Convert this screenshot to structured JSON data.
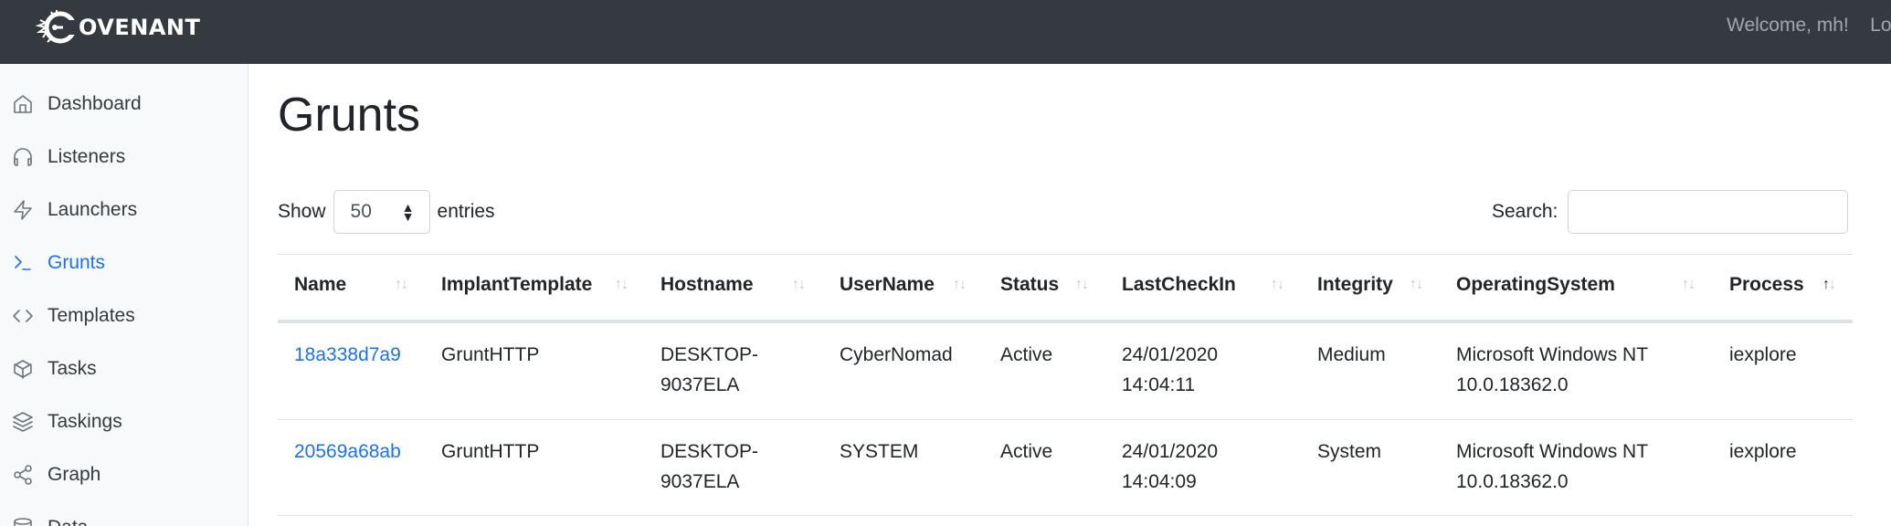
{
  "app": {
    "brand": "OVENANT",
    "welcome": "Welcome, mh!",
    "logout_partial": "Lo"
  },
  "sidebar": {
    "items": [
      {
        "label": "Dashboard",
        "icon": "home-icon"
      },
      {
        "label": "Listeners",
        "icon": "headphones-icon"
      },
      {
        "label": "Launchers",
        "icon": "zap-icon"
      },
      {
        "label": "Grunts",
        "icon": "terminal-icon",
        "active": true
      },
      {
        "label": "Templates",
        "icon": "code-icon"
      },
      {
        "label": "Tasks",
        "icon": "box-icon"
      },
      {
        "label": "Taskings",
        "icon": "layers-icon"
      },
      {
        "label": "Graph",
        "icon": "share-icon"
      },
      {
        "label": "Data",
        "icon": "database-icon"
      }
    ]
  },
  "page": {
    "title": "Grunts",
    "show_label": "Show",
    "entries_value": "50",
    "entries_label": "entries",
    "search_label": "Search:",
    "search_value": ""
  },
  "table": {
    "columns": [
      "Name",
      "ImplantTemplate",
      "Hostname",
      "UserName",
      "Status",
      "LastCheckIn",
      "Integrity",
      "OperatingSystem",
      "Process"
    ],
    "sorted_column": "Process",
    "rows": [
      {
        "name": "18a338d7a9",
        "template": "GruntHTTP",
        "hostname": [
          "DESKTOP-",
          "9037ELA"
        ],
        "username": "CyberNomad",
        "status": "Active",
        "lastcheckin": [
          "24/01/2020",
          "14:04:11"
        ],
        "integrity": "Medium",
        "os": [
          "Microsoft Windows NT",
          "10.0.18362.0"
        ],
        "process": "iexplore"
      },
      {
        "name": "20569a68ab",
        "template": "GruntHTTP",
        "hostname": [
          "DESKTOP-",
          "9037ELA"
        ],
        "username": "SYSTEM",
        "status": "Active",
        "lastcheckin": [
          "24/01/2020",
          "14:04:09"
        ],
        "integrity": "System",
        "os": [
          "Microsoft Windows NT",
          "10.0.18362.0"
        ],
        "process": "iexplore"
      }
    ]
  },
  "colors": {
    "navbar": "#343a40",
    "sidebar": "#f8f9fa",
    "accent": "#1a73e8"
  }
}
